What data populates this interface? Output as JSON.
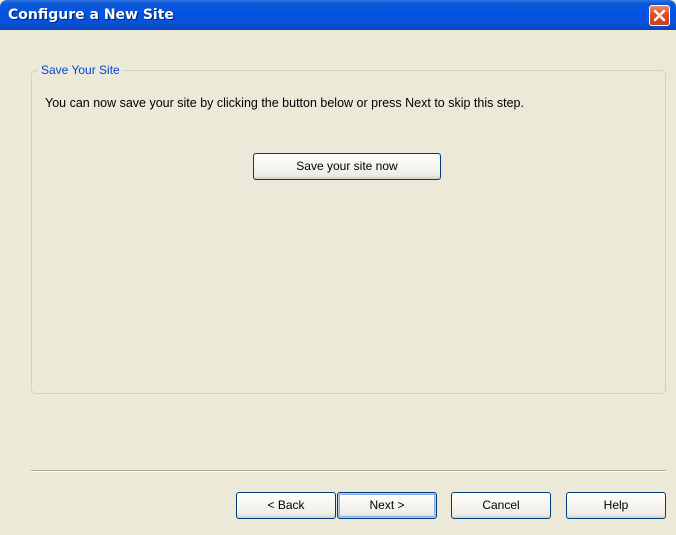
{
  "window": {
    "title": "Configure a New Site"
  },
  "title_bar": {
    "close_icon": "close-icon",
    "color_start": "#2f75e6",
    "color_end": "#0a44b8",
    "close_color": "#db4f26"
  },
  "group": {
    "legend": "Save Your Site",
    "instruction": "You can now save your site by clicking the button below or press Next to skip this step.",
    "save_button_label": "Save your site now",
    "legend_color": "#0046d5"
  },
  "footer": {
    "back_label": "< Back",
    "next_label": "Next >",
    "cancel_label": "Cancel",
    "help_label": "Help"
  },
  "colors": {
    "dialog_background": "#ece9d8",
    "button_border": "#003c74"
  }
}
